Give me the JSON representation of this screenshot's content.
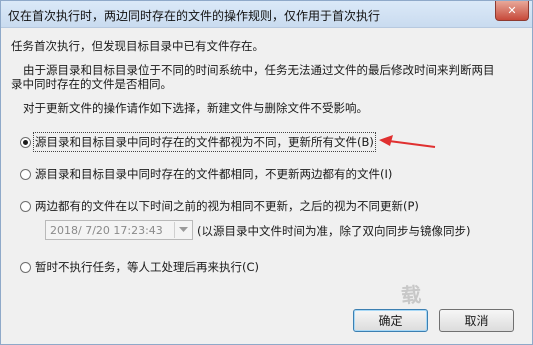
{
  "dialog": {
    "title": "仅在首次执行时，两边同时存在的文件的操作规则，仅作用于首次执行",
    "close_glyph": "✕"
  },
  "info": {
    "line1": "任务首次执行，但发现目标目录中已有文件存在。",
    "line2a": "由于源目录和目标目录位于不同的时间系统中，任务无法通过文件的最后修改时间来判断两目",
    "line2b": "录中同时存在的文件是否相同。",
    "line3": "对于更新文件的操作请作如下选择，新建文件与删除文件不受影响。"
  },
  "options": [
    {
      "label": "源目录和目标目录中同时存在的文件都视为不同，更新所有文件(B)",
      "checked": true
    },
    {
      "label": "源目录和目标目录中同时存在的文件都相同，不更新两边都有的文件(I)",
      "checked": false
    },
    {
      "label": "两边都有的文件在以下时间之前的视为相同不更新，之后的视为不同更新(P)",
      "checked": false
    },
    {
      "label": "暂时不执行任务，等人工处理后再来执行(C)",
      "checked": false
    }
  ],
  "datetime": {
    "value": "2018/ 7/20  17:23:43",
    "note": "(以源目录中文件时间为准，除了双向同步与镜像同步)"
  },
  "buttons": {
    "ok": "确定",
    "cancel": "取消"
  },
  "watermark": "载"
}
